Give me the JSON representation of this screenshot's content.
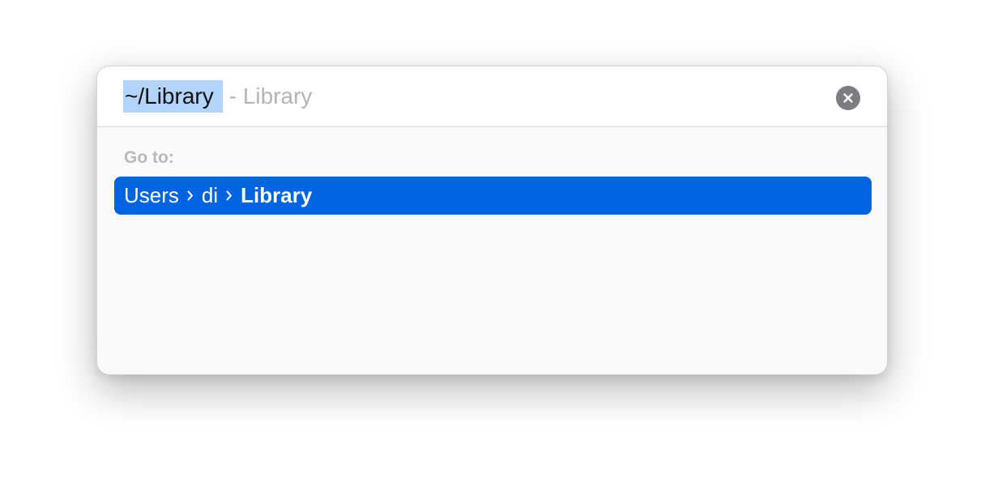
{
  "search": {
    "typed_path": "~/Library",
    "completion_hint": "- Library",
    "clear_icon": "xmark-circle-icon"
  },
  "goto_label": "Go to:",
  "result": {
    "crumbs": [
      "Users",
      "di",
      "Library"
    ],
    "separator_icon": "chevron-right-icon"
  },
  "colors": {
    "selection_highlight": "#b3d4fc",
    "row_accent": "#0064e1",
    "clear_button": "#7d7d81"
  }
}
